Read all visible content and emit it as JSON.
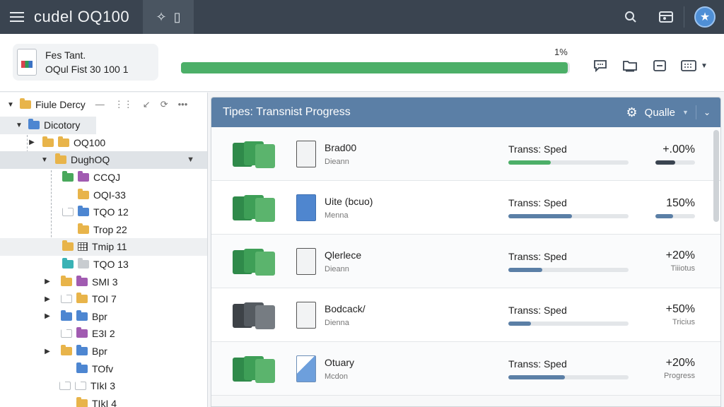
{
  "app": {
    "title": "cudel OQ100"
  },
  "summary": {
    "file_line1": "Fes Tant.",
    "file_line2": "OQul Fist 30 100 1",
    "percent_label": "1%",
    "progress": 0.995
  },
  "tree": {
    "header": "Fiule Dercy",
    "items": [
      {
        "label": "Dicotory"
      },
      {
        "label": "OQ100"
      },
      {
        "label": "DughOQ"
      },
      {
        "label": "CCQJ"
      },
      {
        "label": "OQI-33"
      },
      {
        "label": "TQO 12"
      },
      {
        "label": "Trop 22"
      },
      {
        "label": "Tmip 11"
      },
      {
        "label": "TQO 13"
      },
      {
        "label": "SMI 3"
      },
      {
        "label": "TOI 7"
      },
      {
        "label": "Bpr"
      },
      {
        "label": "E3I 2"
      },
      {
        "label": "Bpr"
      },
      {
        "label": "TOfv"
      },
      {
        "label": "TIkI 3"
      },
      {
        "label": "TIkI 4"
      }
    ]
  },
  "panel": {
    "title": "Tipes: Transnist Progress",
    "quality_label": "Qualle",
    "transfers": [
      {
        "name": "Brad00",
        "sub": "Dieann",
        "speed_label": "Transs: Sped",
        "speed_fraction": 0.35,
        "speed_color": "#4caf68",
        "percent": "+.00%",
        "percent_sub": "",
        "mini_fraction": 0.5,
        "mini_color": "#3a4450"
      },
      {
        "name": "Uite (bcuo)",
        "sub": "Menna",
        "speed_label": "Transs: Sped",
        "speed_fraction": 0.53,
        "speed_color": "#5b7fa6",
        "percent": "150%",
        "percent_sub": "",
        "mini_fraction": 0.45,
        "mini_color": "#5b7fa6"
      },
      {
        "name": "Qlerlece",
        "sub": "Dieann",
        "speed_label": "Transs: Sped",
        "speed_fraction": 0.28,
        "speed_color": "#5b7fa6",
        "percent": "+20%",
        "percent_sub": "Tiiiotus",
        "mini_fraction": 0,
        "mini_color": "#5b7fa6"
      },
      {
        "name": "Bodcack/",
        "sub": "Dienna",
        "speed_label": "Transs: Sped",
        "speed_fraction": 0.19,
        "speed_color": "#5b7fa6",
        "percent": "+50%",
        "percent_sub": "Tricius",
        "mini_fraction": 0,
        "mini_color": "#5b7fa6"
      },
      {
        "name": "Otuary",
        "sub": "Mcdon",
        "speed_label": "Transs: Sped",
        "speed_fraction": 0.47,
        "speed_color": "#5b7fa6",
        "percent": "+20%",
        "percent_sub": "Progress",
        "mini_fraction": 0,
        "mini_color": "#5b7fa6"
      }
    ]
  }
}
